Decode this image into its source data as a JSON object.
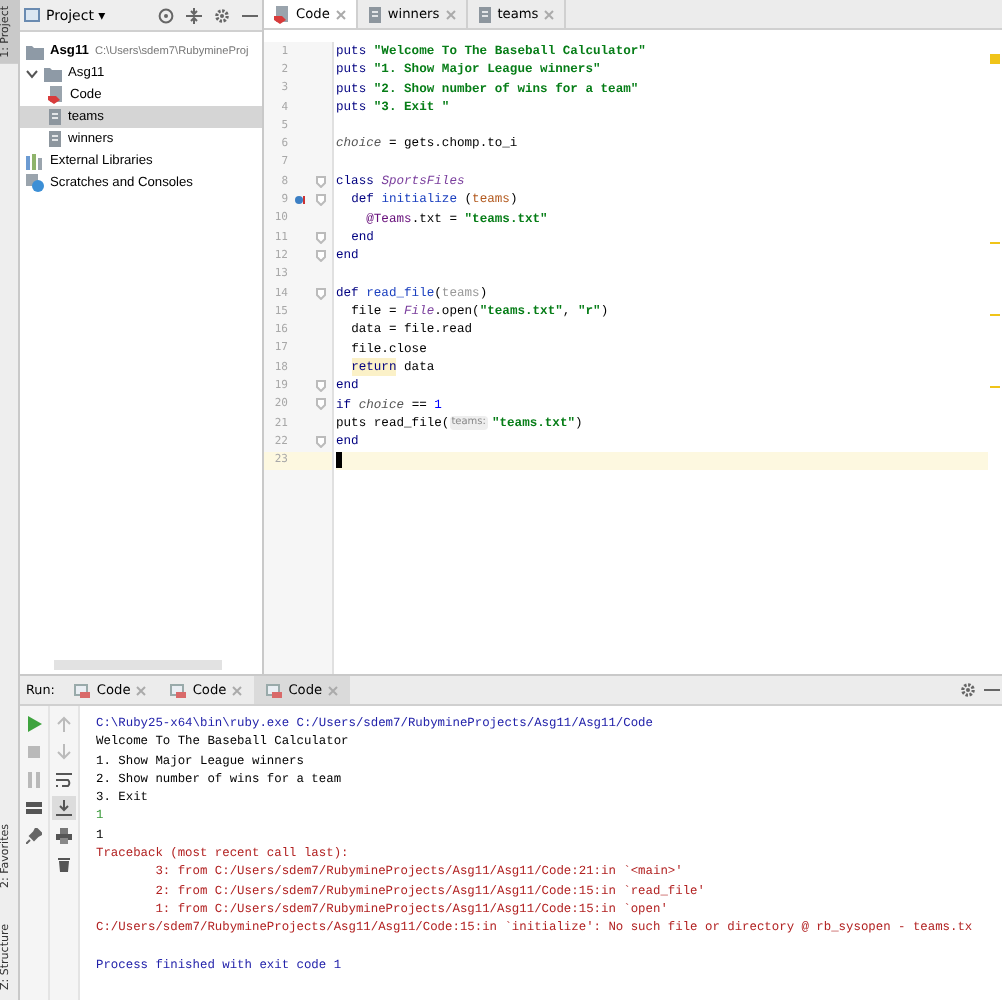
{
  "side_tabs_top": [
    {
      "label": "1: Project",
      "selected": true
    }
  ],
  "side_tabs_bottom": [
    {
      "label": "2: Favorites",
      "selected": false
    },
    {
      "label": "Z: Structure",
      "selected": false
    }
  ],
  "project": {
    "title": "Project ▾",
    "tree": [
      {
        "label": "Asg11",
        "path": "C:\\Users\\sdem7\\RubymineProj",
        "kind": "module",
        "bold": true,
        "selected": false
      },
      {
        "label": "Asg11",
        "kind": "folder",
        "expanded": true,
        "selected": false,
        "children": [
          {
            "label": "Code",
            "kind": "ruby",
            "selected": false
          },
          {
            "label": "teams",
            "kind": "file",
            "selected": true
          },
          {
            "label": "winners",
            "kind": "file",
            "selected": false
          }
        ]
      },
      {
        "label": "External Libraries",
        "kind": "libraries",
        "selected": false
      },
      {
        "label": "Scratches and Consoles",
        "kind": "scratches",
        "selected": false
      }
    ]
  },
  "editor": {
    "tabs": [
      {
        "label": "Code",
        "kind": "ruby",
        "selected": true
      },
      {
        "label": "winners",
        "kind": "file",
        "selected": false
      },
      {
        "label": "teams",
        "kind": "file",
        "selected": false
      }
    ],
    "lines": [
      {
        "n": "1",
        "segs": [
          {
            "t": "puts",
            "kind": "keyword"
          },
          {
            "t": " \"Welcome To The Baseball Calculator\"",
            "kind": "string"
          }
        ]
      },
      {
        "n": "2",
        "segs": [
          {
            "t": "puts",
            "kind": "keyword"
          },
          {
            "t": " \"1. Show Major League winners\"",
            "kind": "string"
          }
        ]
      },
      {
        "n": "3",
        "segs": [
          {
            "t": "puts",
            "kind": "keyword"
          },
          {
            "t": " \"2. Show number of wins for a team\"",
            "kind": "string"
          }
        ]
      },
      {
        "n": "4",
        "segs": [
          {
            "t": "puts",
            "kind": "keyword"
          },
          {
            "t": " \"3. Exit \"",
            "kind": "string"
          }
        ]
      },
      {
        "n": "5"
      },
      {
        "n": "6",
        "segs": [
          {
            "t": "choice",
            "kind": "variable"
          },
          {
            "t": " = gets.chomp.to_i",
            "kind": "plain"
          }
        ]
      },
      {
        "n": "7"
      },
      {
        "n": "8",
        "fold": true,
        "segs": [
          {
            "t": "class",
            "kind": "keyword"
          },
          {
            "t": " SportsFiles",
            "kind": "constant"
          }
        ]
      },
      {
        "n": "9",
        "fold": true,
        "override": true,
        "segs": [
          {
            "t": "  def",
            "kind": "keyword"
          },
          {
            "t": " initialize",
            "kind": "method"
          },
          {
            "t": " (",
            "kind": "plain"
          },
          {
            "t": "teams",
            "kind": "parameter"
          },
          {
            "t": ")",
            "kind": "plain"
          }
        ]
      },
      {
        "n": "10",
        "segs": [
          {
            "t": "    @Teams",
            "kind": "instance"
          },
          {
            "t": ".txt = ",
            "kind": "plain"
          },
          {
            "t": "\"teams.txt\"",
            "kind": "string"
          }
        ]
      },
      {
        "n": "11",
        "fold": true,
        "segs": [
          {
            "t": "  end",
            "kind": "keyword"
          }
        ]
      },
      {
        "n": "12",
        "fold": true,
        "segs": [
          {
            "t": "end",
            "kind": "keyword"
          }
        ]
      },
      {
        "n": "13"
      },
      {
        "n": "14",
        "fold": true,
        "segs": [
          {
            "t": "def",
            "kind": "keyword"
          },
          {
            "t": " read_file",
            "kind": "method"
          },
          {
            "t": "(",
            "kind": "plain"
          },
          {
            "t": "teams",
            "kind": "unused"
          },
          {
            "t": ")",
            "kind": "plain"
          }
        ]
      },
      {
        "n": "15",
        "segs": [
          {
            "t": "  file = ",
            "kind": "plain"
          },
          {
            "t": "File",
            "kind": "constant"
          },
          {
            "t": ".open(",
            "kind": "plain"
          },
          {
            "t": "\"teams.txt\"",
            "kind": "string"
          },
          {
            "t": ", ",
            "kind": "plain"
          },
          {
            "t": "\"r\"",
            "kind": "string"
          },
          {
            "t": ")",
            "kind": "plain"
          }
        ]
      },
      {
        "n": "16",
        "segs": [
          {
            "t": "  data = file.read",
            "kind": "plain"
          }
        ]
      },
      {
        "n": "17",
        "segs": [
          {
            "t": "  file.close",
            "kind": "plain"
          }
        ]
      },
      {
        "n": "18",
        "segs": [
          {
            "t": "  return",
            "kind": "warning"
          },
          {
            "t": " data",
            "kind": "plain"
          }
        ]
      },
      {
        "n": "19",
        "fold": true,
        "segs": [
          {
            "t": "end",
            "kind": "keyword"
          }
        ]
      },
      {
        "n": "20",
        "fold": true,
        "segs": [
          {
            "t": "if",
            "kind": "keyword"
          },
          {
            "t": " choice",
            "kind": "variable"
          },
          {
            "t": " == ",
            "kind": "plain"
          },
          {
            "t": "1",
            "kind": "number"
          }
        ]
      },
      {
        "n": "21",
        "segs": [
          {
            "t": "puts read_file(",
            "kind": "plain"
          },
          {
            "t": "teams:",
            "kind": "hint"
          },
          {
            "t": "\"teams.txt\"",
            "kind": "string"
          },
          {
            "t": ")",
            "kind": "plain"
          }
        ]
      },
      {
        "n": "22",
        "fold": true,
        "segs": [
          {
            "t": "end",
            "kind": "keyword"
          }
        ]
      },
      {
        "n": "23",
        "current": true
      }
    ]
  },
  "run": {
    "label": "Run:",
    "tabs": [
      {
        "label": "Code",
        "selected": false
      },
      {
        "label": "Code",
        "selected": false
      },
      {
        "label": "Code",
        "selected": true
      }
    ],
    "output": [
      {
        "t": "C:\\Ruby25-x64\\bin\\ruby.exe C:/Users/sdem7/RubymineProjects/Asg11/Asg11/Code",
        "kind": "command"
      },
      {
        "t": "Welcome To The Baseball Calculator",
        "kind": "output"
      },
      {
        "t": "1. Show Major League winners",
        "kind": "output"
      },
      {
        "t": "2. Show number of wins for a team",
        "kind": "output"
      },
      {
        "t": "3. Exit",
        "kind": "output"
      },
      {
        "t": "1",
        "kind": "input"
      },
      {
        "t": "1",
        "kind": "output"
      },
      {
        "t": "Traceback (most recent call last):",
        "kind": "error"
      },
      {
        "t": "        3: from C:/Users/sdem7/RubymineProjects/Asg11/Asg11/Code:21:in `<main>'",
        "kind": "error"
      },
      {
        "t": "        2: from C:/Users/sdem7/RubymineProjects/Asg11/Asg11/Code:15:in `read_file'",
        "kind": "error"
      },
      {
        "t": "        1: from C:/Users/sdem7/RubymineProjects/Asg11/Asg11/Code:15:in `open'",
        "kind": "error"
      },
      {
        "t": "C:/Users/sdem7/RubymineProjects/Asg11/Asg11/Code:15:in `initialize': No such file or directory @ rb_sysopen - teams.tx",
        "kind": "error"
      },
      {
        "kind": "blank"
      },
      {
        "t": "Process finished with exit code 1",
        "kind": "command"
      }
    ]
  }
}
